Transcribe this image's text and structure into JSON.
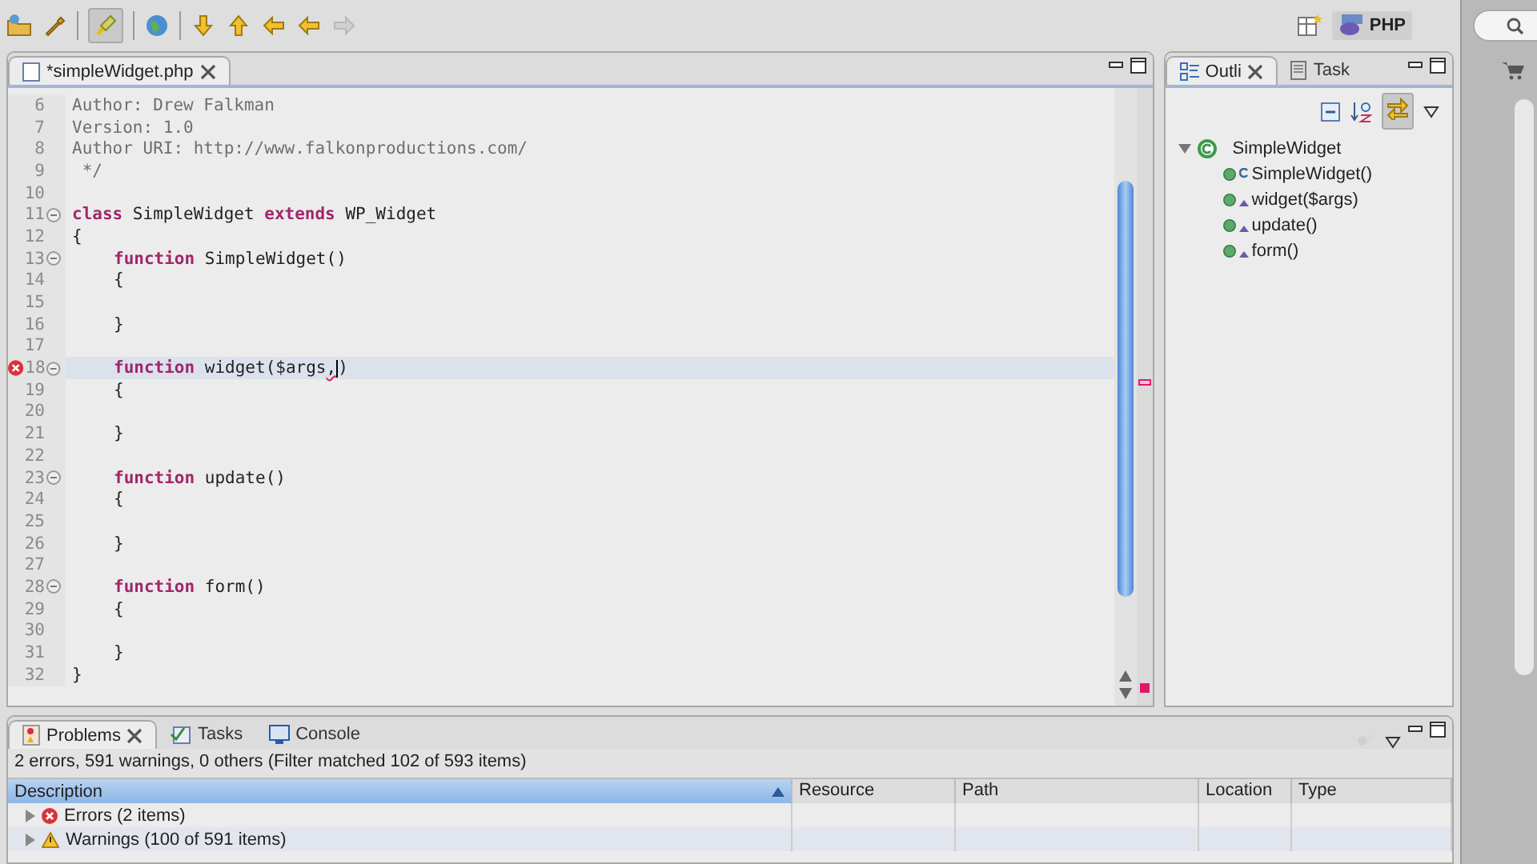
{
  "toolbar": {
    "perspective": {
      "label": "PHP",
      "selected": true
    }
  },
  "editor": {
    "tab": {
      "label": "*simpleWidget.php",
      "selected": true
    },
    "lines": [
      {
        "number": "6",
        "foldable": false,
        "error": false,
        "current": false,
        "indented": false,
        "segments": [
          {
            "kind": "comment",
            "text": "Author: Drew Falkman"
          }
        ]
      },
      {
        "number": "7",
        "foldable": false,
        "error": false,
        "current": false,
        "indented": false,
        "segments": [
          {
            "kind": "comment",
            "text": "Version: 1.0"
          }
        ]
      },
      {
        "number": "8",
        "foldable": false,
        "error": false,
        "current": false,
        "indented": false,
        "segments": [
          {
            "kind": "comment",
            "text": "Author URI: http://www.falkonproductions.com/"
          }
        ]
      },
      {
        "number": "9",
        "foldable": false,
        "error": false,
        "current": false,
        "indented": false,
        "segments": [
          {
            "kind": "comment",
            "text": " */"
          }
        ]
      },
      {
        "number": "10",
        "foldable": false,
        "error": false,
        "current": false
      },
      {
        "number": "11",
        "foldable": true,
        "error": false,
        "current": false,
        "indented": false,
        "segments": [
          {
            "kind": "keyword",
            "text": "class"
          },
          {
            "kind": "plain",
            "text": " SimpleWidget "
          },
          {
            "kind": "keyword",
            "text": "extends"
          },
          {
            "kind": "plain",
            "text": " WP_Widget"
          }
        ]
      },
      {
        "number": "12",
        "foldable": false,
        "error": false,
        "current": false,
        "indented": false,
        "segments": [
          {
            "kind": "plain",
            "text": "{"
          }
        ]
      },
      {
        "number": "13",
        "foldable": true,
        "error": false,
        "current": false,
        "indented": true,
        "segments": [
          {
            "kind": "keyword",
            "text": "function"
          },
          {
            "kind": "plain",
            "text": " SimpleWidget()"
          }
        ]
      },
      {
        "number": "14",
        "foldable": false,
        "error": false,
        "current": false,
        "indented": true,
        "segments": [
          {
            "kind": "plain",
            "text": "{"
          }
        ]
      },
      {
        "number": "15",
        "foldable": false,
        "error": false,
        "current": false
      },
      {
        "number": "16",
        "foldable": false,
        "error": false,
        "current": false,
        "indented": true,
        "segments": [
          {
            "kind": "plain",
            "text": "}"
          }
        ]
      },
      {
        "number": "17",
        "foldable": false,
        "error": false,
        "current": false
      },
      {
        "number": "18",
        "foldable": true,
        "error": true,
        "current": true,
        "indented": true,
        "segments": [
          {
            "kind": "keyword",
            "text": "function"
          },
          {
            "kind": "plain",
            "text": " widget($args"
          },
          {
            "kind": "squiggle",
            "text": ",",
            "cursor": true
          },
          {
            "kind": "plain",
            "text": ")"
          }
        ]
      },
      {
        "number": "19",
        "foldable": false,
        "error": false,
        "current": false,
        "indented": true,
        "segments": [
          {
            "kind": "plain",
            "text": "{"
          }
        ]
      },
      {
        "number": "20",
        "foldable": false,
        "error": false,
        "current": false
      },
      {
        "number": "21",
        "foldable": false,
        "error": false,
        "current": false,
        "indented": true,
        "segments": [
          {
            "kind": "plain",
            "text": "}"
          }
        ]
      },
      {
        "number": "22",
        "foldable": false,
        "error": false,
        "current": false
      },
      {
        "number": "23",
        "foldable": true,
        "error": false,
        "current": false,
        "indented": true,
        "segments": [
          {
            "kind": "keyword",
            "text": "function"
          },
          {
            "kind": "plain",
            "text": " update()"
          }
        ]
      },
      {
        "number": "24",
        "foldable": false,
        "error": false,
        "current": false,
        "indented": true,
        "segments": [
          {
            "kind": "plain",
            "text": "{"
          }
        ]
      },
      {
        "number": "25",
        "foldable": false,
        "error": false,
        "current": false
      },
      {
        "number": "26",
        "foldable": false,
        "error": false,
        "current": false,
        "indented": true,
        "segments": [
          {
            "kind": "plain",
            "text": "}"
          }
        ]
      },
      {
        "number": "27",
        "foldable": false,
        "error": false,
        "current": false
      },
      {
        "number": "28",
        "foldable": true,
        "error": false,
        "current": false,
        "indented": true,
        "segments": [
          {
            "kind": "keyword",
            "text": "function"
          },
          {
            "kind": "plain",
            "text": " form()"
          }
        ]
      },
      {
        "number": "29",
        "foldable": false,
        "error": false,
        "current": false,
        "indented": true,
        "segments": [
          {
            "kind": "plain",
            "text": "{"
          }
        ]
      },
      {
        "number": "30",
        "foldable": false,
        "error": false,
        "current": false
      },
      {
        "number": "31",
        "foldable": false,
        "error": false,
        "current": false,
        "indented": true,
        "segments": [
          {
            "kind": "plain",
            "text": "}"
          }
        ]
      },
      {
        "number": "32",
        "foldable": false,
        "error": false,
        "current": false,
        "indented": false,
        "segments": [
          {
            "kind": "plain",
            "text": "}"
          }
        ]
      }
    ]
  },
  "outline": {
    "tabs": [
      {
        "label": "Outli",
        "selected": true
      },
      {
        "label": "Task",
        "selected": false
      }
    ],
    "tree": [
      {
        "label": "SimpleWidget",
        "expanded": true,
        "children": [
          {
            "label": "SimpleWidget()",
            "constructor": true
          },
          {
            "label": "widget($args)",
            "constructor": false
          },
          {
            "label": "update()",
            "constructor": false
          },
          {
            "label": "form()",
            "constructor": false
          }
        ]
      }
    ]
  },
  "problems": {
    "tabs": [
      {
        "label": "Problems",
        "selected": true
      },
      {
        "label": "Tasks",
        "selected": false
      },
      {
        "label": "Console",
        "selected": false
      }
    ],
    "summary": "2 errors, 591 warnings, 0 others (Filter matched 102 of 593 items)",
    "columns": [
      "Description",
      "Resource",
      "Path",
      "Location",
      "Type"
    ],
    "rows": [
      {
        "kind": "error",
        "label": "Errors (2 items)",
        "expanded": false
      },
      {
        "kind": "warning",
        "label": "Warnings (100 of 591 items)",
        "expanded": false
      }
    ]
  }
}
